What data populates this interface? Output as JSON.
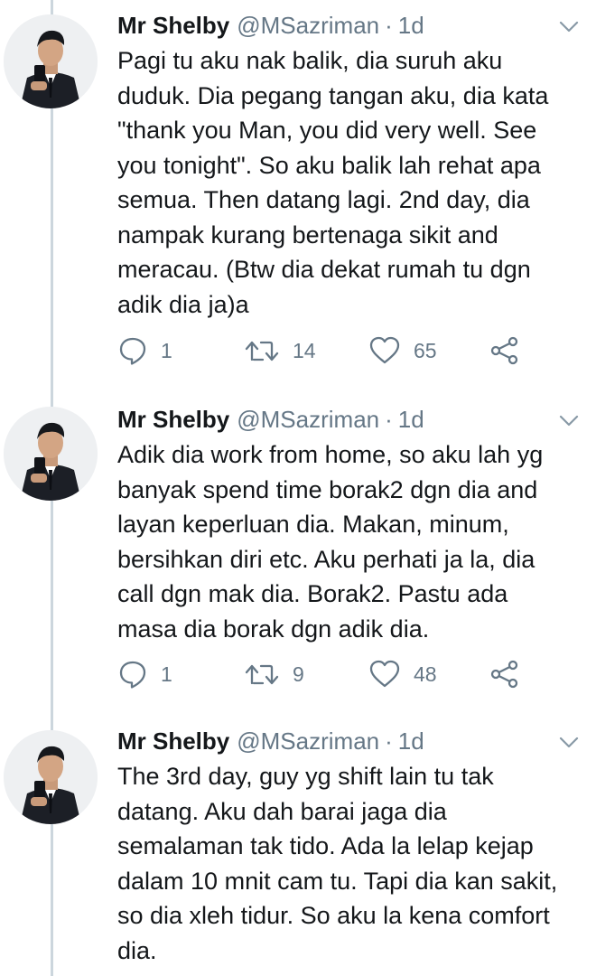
{
  "tweets": [
    {
      "name": "Mr Shelby",
      "handle": "@MSazriman",
      "separator": "·",
      "time": "1d",
      "text": "Pagi tu aku nak balik, dia suruh aku\nduduk. Dia pegang tangan aku, dia kata\n\"thank you Man, you did very well. See\nyou tonight\". So aku balik lah rehat apa\nsemua. Then datang lagi. 2nd day, dia\nnampak kurang bertenaga sikit and\nmeracau. (Btw dia dekat rumah tu dgn\nadik dia ja)a",
      "replies": "1",
      "retweets": "14",
      "likes": "65"
    },
    {
      "name": "Mr Shelby",
      "handle": "@MSazriman",
      "separator": "·",
      "time": "1d",
      "text": "Adik dia work from home, so aku lah yg\nbanyak spend time borak2 dgn dia and\nlayan keperluan dia. Makan, minum,\nbersihkan diri etc. Aku perhati ja la, dia\ncall dgn mak dia. Borak2. Pastu ada\nmasa dia borak dgn adik dia.",
      "replies": "1",
      "retweets": "9",
      "likes": "48"
    },
    {
      "name": "Mr Shelby",
      "handle": "@MSazriman",
      "separator": "·",
      "time": "1d",
      "text": "The 3rd day, guy yg shift lain tu tak\ndatang. Aku dah barai jaga dia\nsemalaman tak tido. Ada la lelap kejap\ndalam 10 mnit cam tu. Tapi dia kan sakit,\nso dia xleh tidur. So aku la kena comfort\ndia."
    }
  ],
  "icons": {
    "reply": "reply-icon",
    "retweet": "retweet-icon",
    "like": "heart-icon",
    "share": "share-icon",
    "caret": "chevron-down-icon",
    "avatar": "avatar"
  },
  "colors": {
    "text": "#14171a",
    "secondary": "#657786",
    "thread_line": "#ccd6dd",
    "background": "#ffffff"
  }
}
